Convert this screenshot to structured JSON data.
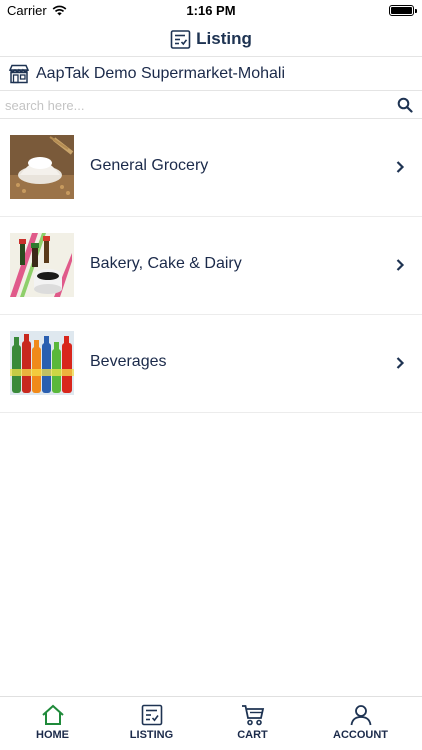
{
  "status_bar": {
    "carrier": "Carrier",
    "time": "1:16 PM"
  },
  "header": {
    "title": "Listing"
  },
  "store": {
    "name": "AapTak Demo Supermarket-Mohali"
  },
  "search": {
    "placeholder": "search here..."
  },
  "categories": [
    {
      "label": "General Grocery"
    },
    {
      "label": "Bakery, Cake & Dairy"
    },
    {
      "label": "Beverages"
    }
  ],
  "tab_bar": {
    "home": "HOME",
    "listing": "LISTING",
    "cart": "CART",
    "account": "ACCOUNT"
  },
  "colors": {
    "primary": "#1e3352",
    "home_icon": "#1f8a3a"
  }
}
